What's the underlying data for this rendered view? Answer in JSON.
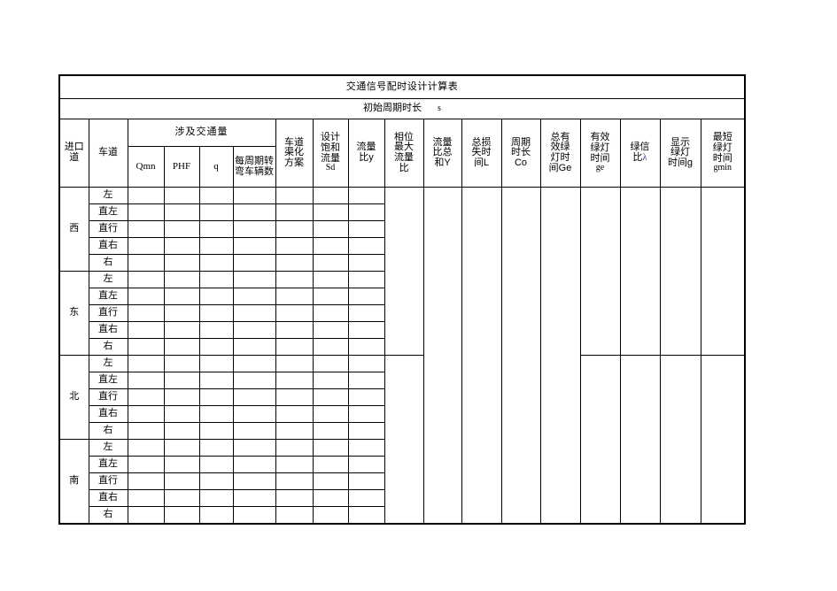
{
  "document": {
    "title": "交通信号配时设计计算表",
    "subtitle_label": "初始周期时长",
    "subtitle_unit": "s"
  },
  "header": {
    "col_entry": "进口道",
    "col_lane": "车道",
    "group_volume": "涉及交通量",
    "sub_qmn": "Qmn",
    "sub_phf": "PHF",
    "sub_q": "q",
    "sub_turn": "每周期转弯车辆数",
    "col_channel_1": "车道",
    "col_channel_2": "渠化",
    "col_channel_3": "方案",
    "col_sat_1": "设计",
    "col_sat_2": "饱和",
    "col_sat_3": "流量",
    "col_sat_4": "Sd",
    "col_ratio_1": "流量",
    "col_ratio_2": "比y",
    "col_phase_1": "相位",
    "col_phase_2": "最大",
    "col_phase_3": "流量",
    "col_phase_4": "比",
    "col_sumy_1": "流量",
    "col_sumy_2": "比总",
    "col_sumy_3": "和Y",
    "col_loss_1": "总损",
    "col_loss_2": "失时",
    "col_loss_3": "间L",
    "col_cycle_1": "周期",
    "col_cycle_2": "时长",
    "col_cycle_3": "Co",
    "col_ge_1": "总有",
    "col_ge_2": "效绿",
    "col_ge_3": "灯时",
    "col_ge_4": "间Ge",
    "col_ge_lower_1": "有效",
    "col_ge_lower_2": "绿灯",
    "col_ge_lower_3": "时间",
    "col_ge_lower_4": "ge",
    "col_split_1": "绿信",
    "col_split_2": "比",
    "col_split_lambda": "λ",
    "col_disp_1": "显示",
    "col_disp_2": "绿灯",
    "col_disp_3": "时间g",
    "col_min_1": "最短",
    "col_min_2": "绿灯",
    "col_min_3": "时间",
    "col_min_4": "gmin"
  },
  "body": {
    "directions": [
      {
        "name": "西",
        "lanes": [
          "左",
          "直左",
          "直行",
          "直右",
          "右"
        ]
      },
      {
        "name": "东",
        "lanes": [
          "左",
          "直左",
          "直行",
          "直右",
          "右"
        ]
      },
      {
        "name": "北",
        "lanes": [
          "左",
          "直左",
          "直行",
          "直右",
          "右"
        ]
      },
      {
        "name": "南",
        "lanes": [
          "左",
          "直左",
          "直行",
          "直右",
          "右"
        ]
      }
    ],
    "empty": ""
  }
}
